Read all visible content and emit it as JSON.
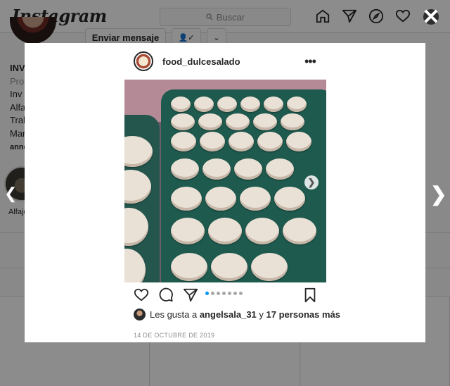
{
  "app": {
    "logo_text": "Instagram",
    "search_placeholder": "Buscar"
  },
  "profile": {
    "message_button": "Enviar mensaje",
    "follow_icon": "user-check-icon",
    "dropdown_icon": "chevron-down-icon",
    "bio_lines": [
      "INV",
      "Prod",
      "Inv",
      "Alfa",
      "Trab",
      "Mar"
    ],
    "bio_link": "anne",
    "highlight_label": "Alfajo"
  },
  "post": {
    "username": "food_dulcesalado",
    "more_icon": "more-horizontal-icon",
    "carousel": {
      "slides": 7,
      "active": 1
    },
    "likes": {
      "prefix": "Les gusta a ",
      "user": "angelsala_31",
      "joiner": " y ",
      "others": "17 personas más"
    },
    "date": "14 DE OCTUBRE DE 2019"
  },
  "colors": {
    "accent": "#0095f6",
    "text": "#262626",
    "muted": "#8e8e8e",
    "border": "#dbdbdb"
  }
}
